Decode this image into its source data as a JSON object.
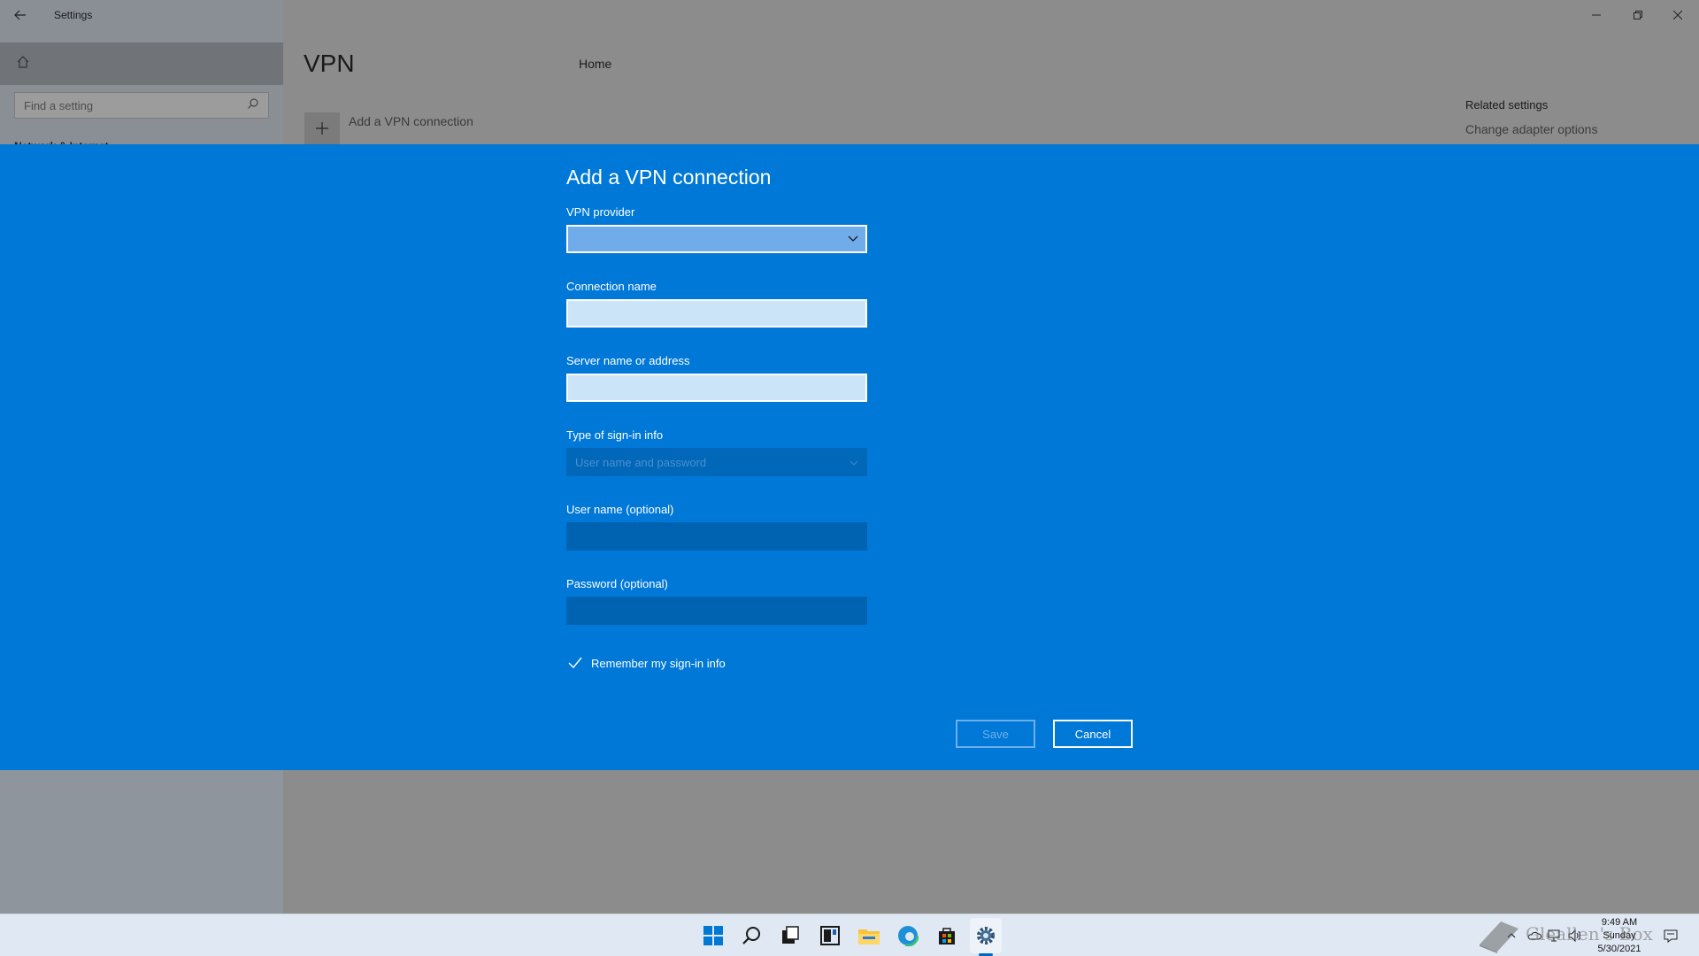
{
  "window": {
    "title": "Settings",
    "controls": {
      "minimize": "minimize-icon",
      "maximize": "restore-icon",
      "close": "close-icon"
    }
  },
  "sidebar": {
    "home_label": "Home",
    "search_placeholder": "Find a setting",
    "section_label": "Network & Internet"
  },
  "main": {
    "title": "VPN",
    "add_label": "Add a VPN connection",
    "related_title": "Related settings",
    "related_link": "Change adapter options"
  },
  "dialog": {
    "title": "Add a VPN connection",
    "vpn_provider_label": "VPN provider",
    "vpn_provider_value": "",
    "connection_name_label": "Connection name",
    "connection_name_value": "",
    "server_label": "Server name or address",
    "server_value": "",
    "signin_type_label": "Type of sign-in info",
    "signin_type_value": "User name and password",
    "username_label": "User name (optional)",
    "username_value": "",
    "password_label": "Password (optional)",
    "password_value": "",
    "remember_label": "Remember my sign-in info",
    "remember_checked": true,
    "save_label": "Save",
    "cancel_label": "Cancel"
  },
  "colors": {
    "dialog_bg": "#0078d7",
    "backdrop": "#8c8c8c",
    "taskbar": "#dfe8f3"
  },
  "taskbar": {
    "icons": [
      "windows-start-icon",
      "search-icon",
      "task-view-icon",
      "widgets-icon",
      "file-explorer-icon",
      "edge-browser-icon",
      "store-icon",
      "settings-gear-icon"
    ],
    "clock": {
      "time": "9:49 AM",
      "day": "Sunday",
      "date": "5/30/2021"
    }
  },
  "watermark": {
    "text": "Gleallen's Box"
  }
}
